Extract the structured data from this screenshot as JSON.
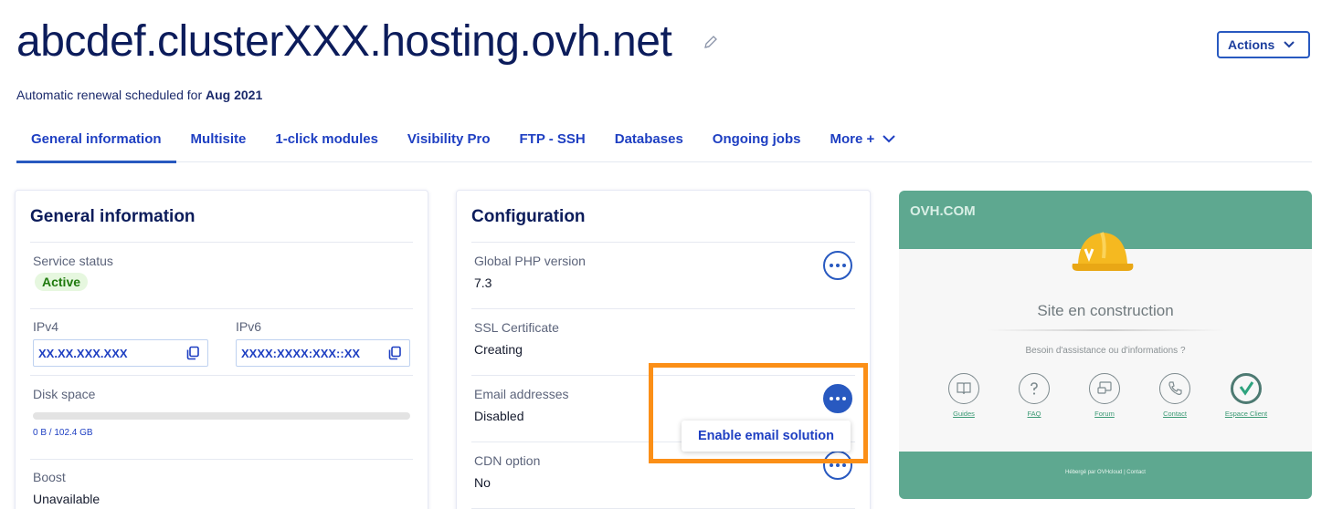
{
  "header": {
    "title": "abcdef.clusterXXX.hosting.ovh.net",
    "renewal_prefix": "Automatic renewal scheduled for",
    "renewal_date": "Aug 2021",
    "actions_label": "Actions"
  },
  "tabs": [
    {
      "label": "General information",
      "active": true
    },
    {
      "label": "Multisite"
    },
    {
      "label": "1-click modules"
    },
    {
      "label": "Visibility Pro"
    },
    {
      "label": "FTP - SSH"
    },
    {
      "label": "Databases"
    },
    {
      "label": "Ongoing jobs"
    },
    {
      "label": "More +"
    }
  ],
  "general": {
    "title": "General information",
    "service_status_label": "Service status",
    "service_status_value": "Active",
    "ipv4_label": "IPv4",
    "ipv4_value": "XX.XX.XXX.XXX",
    "ipv6_label": "IPv6",
    "ipv6_value": "XXXX:XXXX:XXX::XX",
    "disk_label": "Disk space",
    "disk_value": "0 B / 102.4 GB",
    "disk_used_fraction": 0,
    "boost_label": "Boost",
    "boost_value": "Unavailable"
  },
  "configuration": {
    "title": "Configuration",
    "php_label": "Global PHP version",
    "php_value": "7.3",
    "ssl_label": "SSL Certificate",
    "ssl_value": "Creating",
    "email_label": "Email addresses",
    "email_value": "Disabled",
    "cdn_label": "CDN option",
    "cdn_value": "No",
    "dropdown_item": "Enable email solution"
  },
  "preview": {
    "logo": "OVH.COM",
    "title": "Site en construction",
    "subtitle": "Besoin d'assistance ou d'informations ?",
    "links": [
      "Guides",
      "FAQ",
      "Forum",
      "Contact",
      "Espace Client"
    ],
    "footer": "Hébergé par OVHcloud | Contact"
  },
  "colors": {
    "accent": "#2859c0",
    "highlight": "#fb8f17",
    "preview_green": "#5ea890"
  }
}
